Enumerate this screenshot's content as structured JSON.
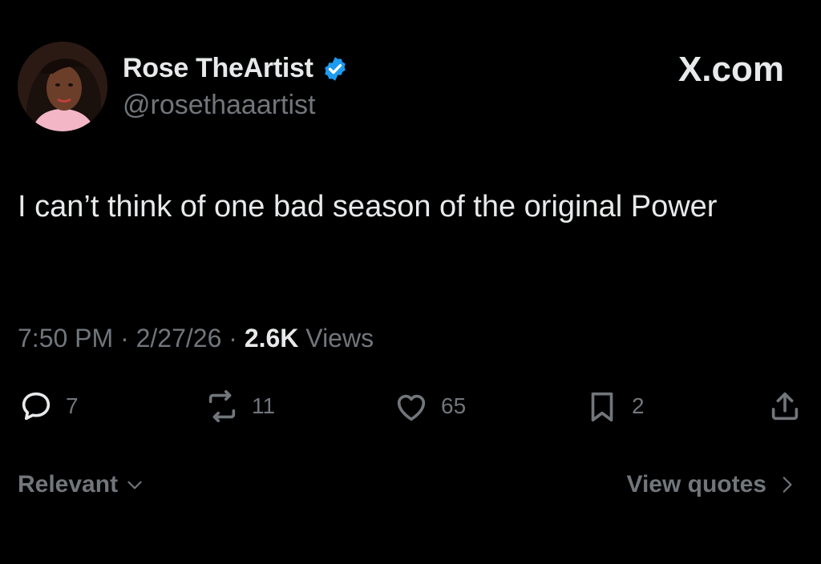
{
  "author": {
    "display_name": "Rose TheArtist",
    "handle": "@rosethaaartist",
    "verified": true
  },
  "watermark": "X.com",
  "post": {
    "text": "I can’t think of one bad season of the original Power",
    "time": "7:50 PM",
    "date": "2/27/26",
    "views_count": "2.6K",
    "views_label": "Views",
    "separator": "·"
  },
  "actions": {
    "replies": "7",
    "reposts": "11",
    "likes": "65",
    "bookmarks": "2"
  },
  "footer": {
    "sort_label": "Relevant",
    "view_quotes_label": "View quotes"
  },
  "colors": {
    "background": "#000000",
    "primary_text": "#e7e9ea",
    "secondary_text": "#71767b",
    "verified_blue": "#1d9bf0"
  },
  "icons": [
    "verified-badge-icon",
    "reply-icon",
    "repost-icon",
    "like-icon",
    "bookmark-icon",
    "share-icon",
    "chevron-down-icon",
    "chevron-right-icon"
  ]
}
